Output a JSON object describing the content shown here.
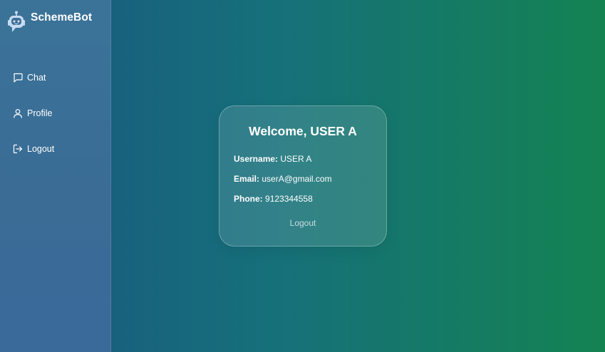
{
  "app": {
    "name": "SchemeBot",
    "logo_icon": "robot-icon"
  },
  "sidebar": {
    "items": [
      {
        "label": "Chat",
        "icon": "chat-icon"
      },
      {
        "label": "Profile",
        "icon": "user-icon"
      },
      {
        "label": "Logout",
        "icon": "logout-icon"
      }
    ]
  },
  "profile": {
    "welcome": "Welcome, USER A",
    "username_label": "Username:",
    "username": "USER A",
    "email_label": "Email:",
    "email": "userA@gmail.com",
    "phone_label": "Phone:",
    "phone": "9123344558",
    "logout_label": "Logout"
  },
  "colors": {
    "background_start": "#19577f",
    "background_end": "#148352",
    "sidebar": "#3a6d97",
    "robot_body": "#c7dcf2"
  }
}
